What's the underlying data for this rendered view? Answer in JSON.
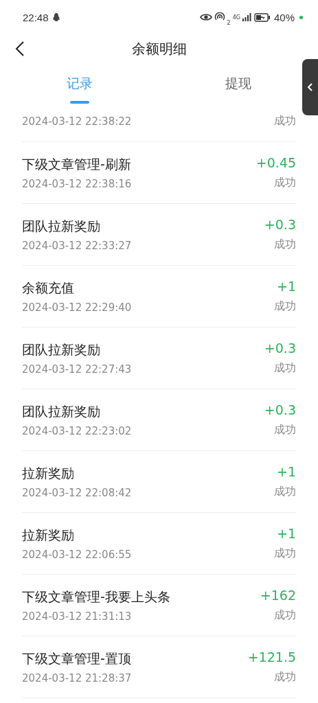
{
  "status_bar": {
    "time": "22:48",
    "signal_label": "2",
    "network_type": "4G",
    "battery": "40%",
    "battery_charging": true
  },
  "header": {
    "title": "余额明细"
  },
  "tabs": [
    {
      "label": "记录",
      "selected": true
    },
    {
      "label": "提现",
      "selected": false
    }
  ],
  "records": [
    {
      "time": "2024-03-12 22:38:22",
      "status": "成功"
    },
    {
      "title": "下级文章管理-刷新",
      "time": "2024-03-12 22:38:16",
      "amount": "+0.45",
      "status": "成功"
    },
    {
      "title": "团队拉新奖励",
      "time": "2024-03-12 22:33:27",
      "amount": "+0.3",
      "status": "成功"
    },
    {
      "title": "余额充值",
      "time": "2024-03-12 22:29:40",
      "amount": "+1",
      "status": "成功"
    },
    {
      "title": "团队拉新奖励",
      "time": "2024-03-12 22:27:43",
      "amount": "+0.3",
      "status": "成功"
    },
    {
      "title": "团队拉新奖励",
      "time": "2024-03-12 22:23:02",
      "amount": "+0.3",
      "status": "成功"
    },
    {
      "title": "拉新奖励",
      "time": "2024-03-12 22:08:42",
      "amount": "+1",
      "status": "成功"
    },
    {
      "title": "拉新奖励",
      "time": "2024-03-12 22:06:55",
      "amount": "+1",
      "status": "成功"
    },
    {
      "title": "下级文章管理-我要上头条",
      "time": "2024-03-12 21:31:13",
      "amount": "+162",
      "status": "成功"
    },
    {
      "title": "下级文章管理-置顶",
      "time": "2024-03-12 21:28:37",
      "amount": "+121.5",
      "status": "成功"
    }
  ]
}
